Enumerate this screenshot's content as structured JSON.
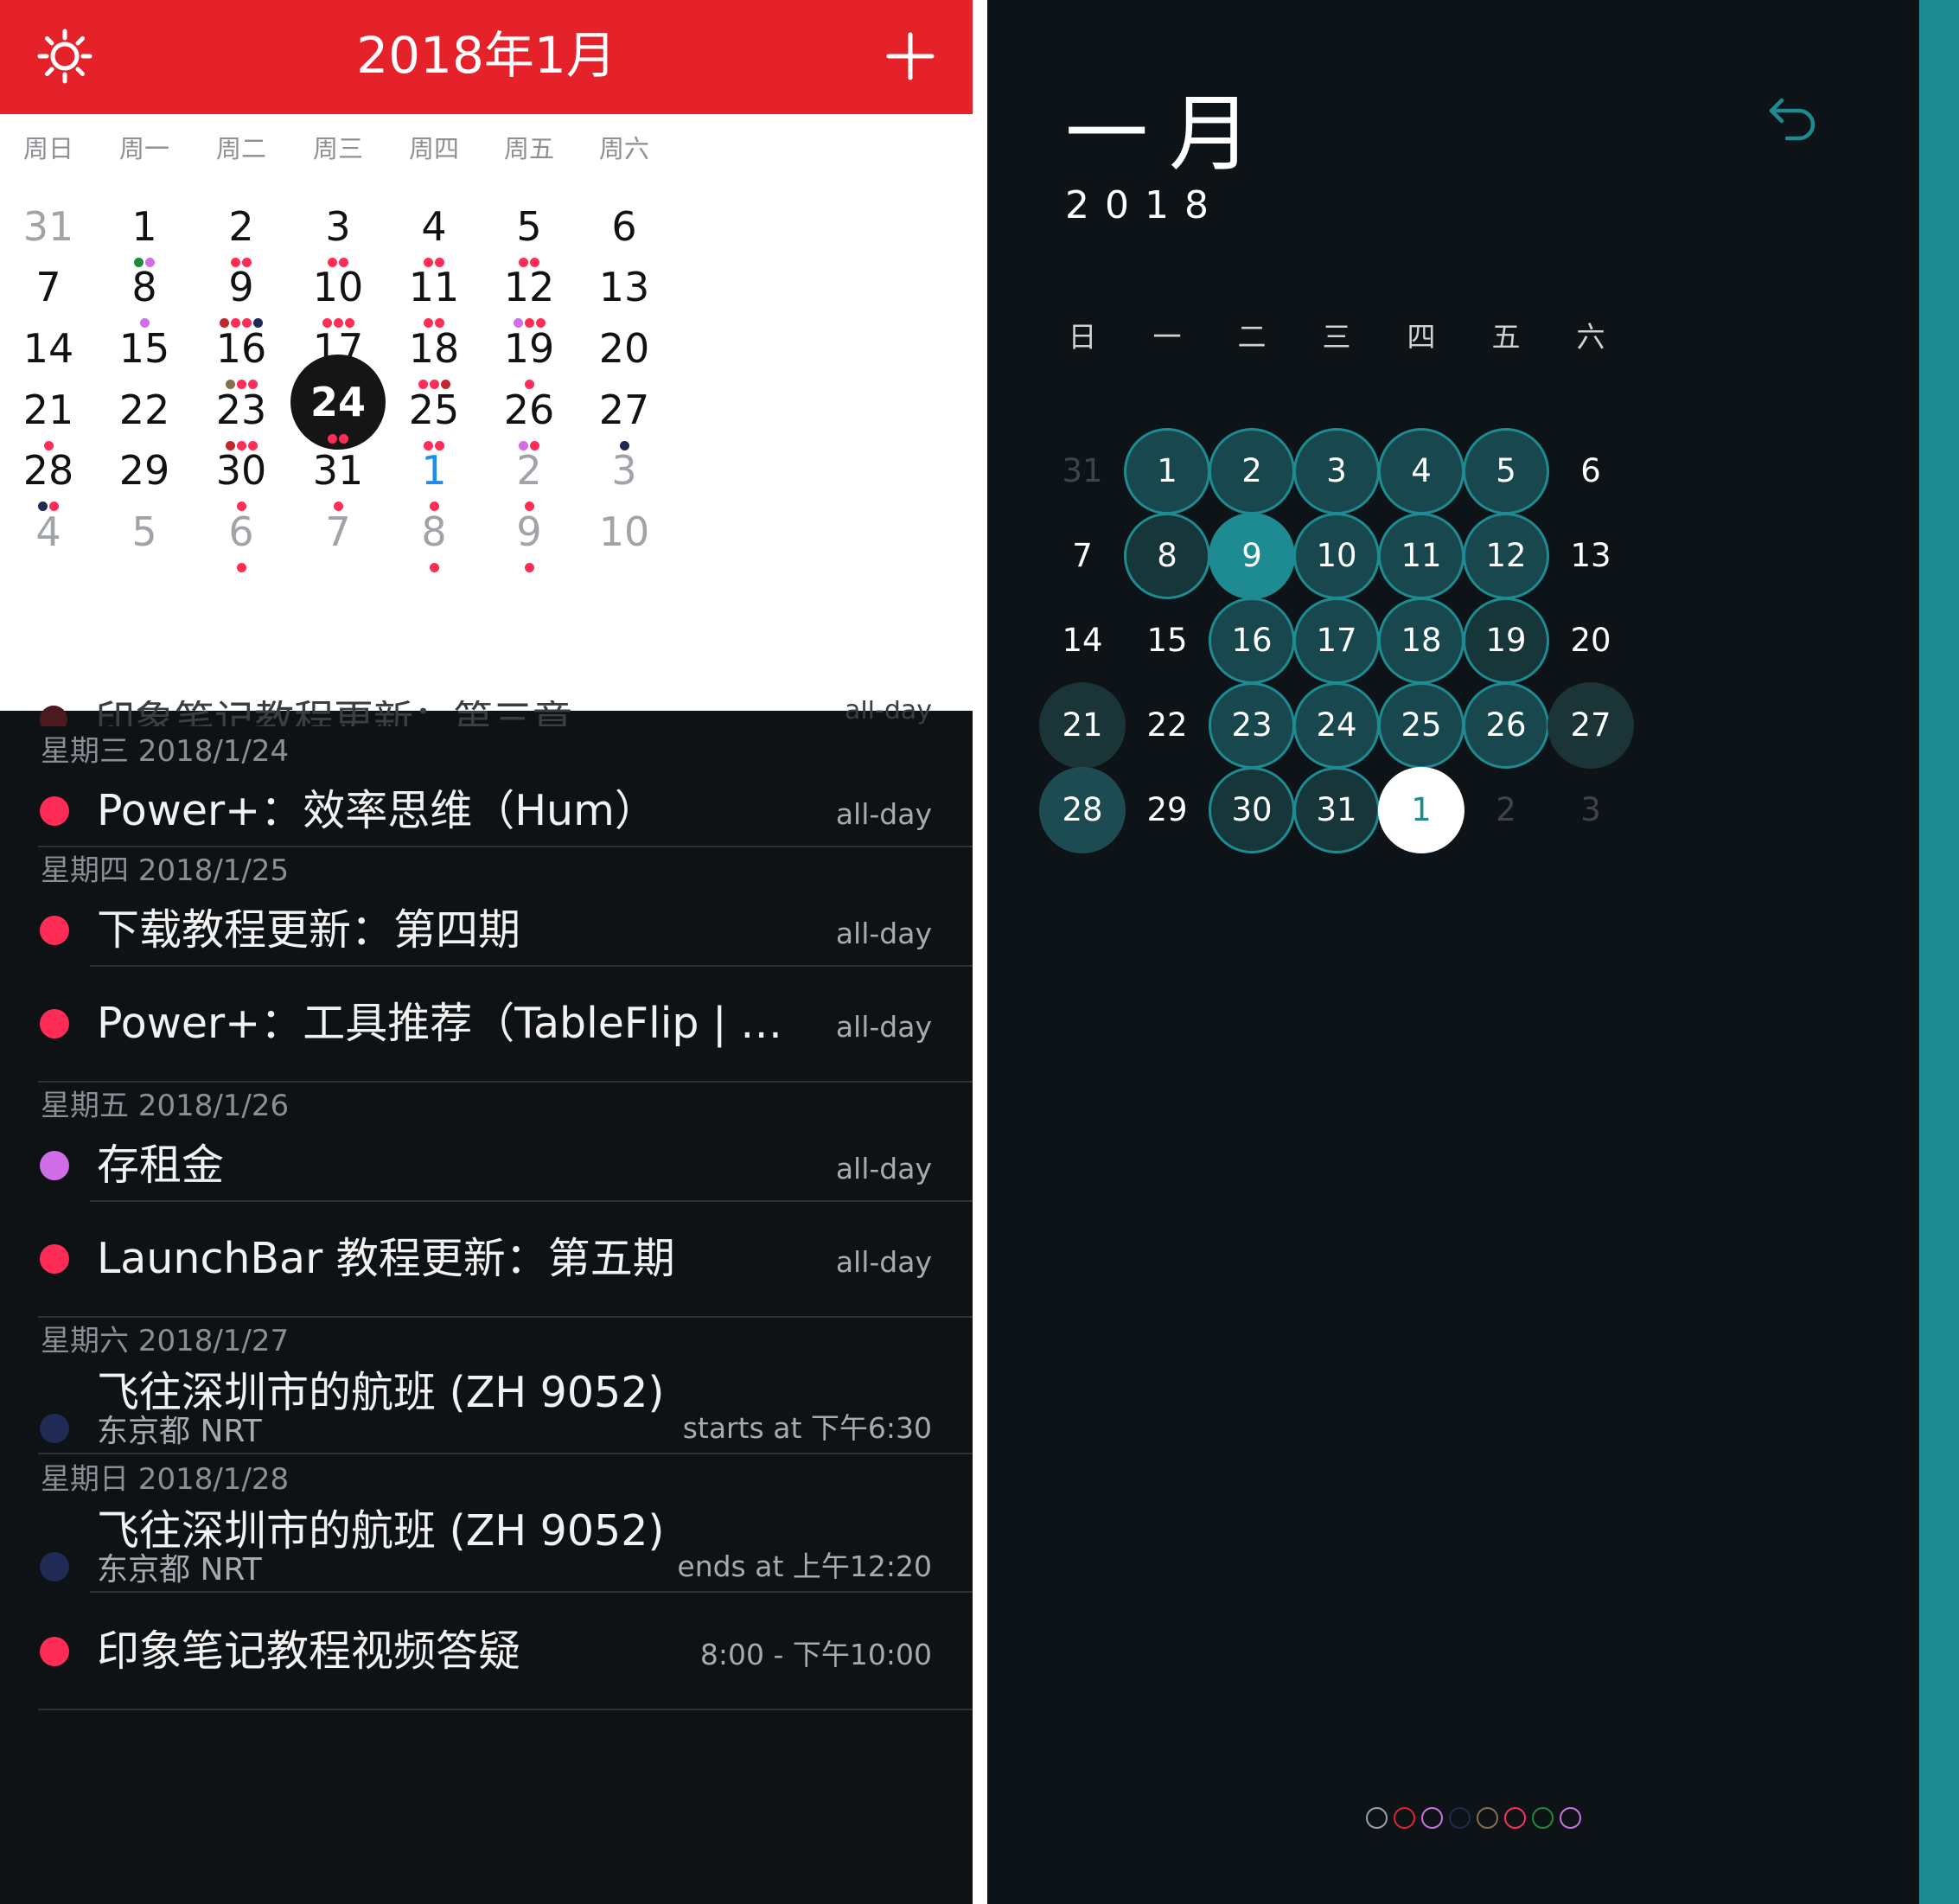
{
  "left": {
    "header": {
      "title": "2018年1月"
    },
    "weekdays": [
      "周日",
      "周一",
      "周二",
      "周三",
      "周四",
      "周五",
      "周六"
    ],
    "weeks": [
      [
        {
          "d": "31",
          "muted": true,
          "dots": []
        },
        {
          "d": "1",
          "dots": [
            "#1f8a3a",
            "#cf6ee8"
          ]
        },
        {
          "d": "2",
          "dots": [
            "#ff2d55",
            "#ff2d55"
          ]
        },
        {
          "d": "3",
          "dots": [
            "#ff2d55",
            "#ff2d55"
          ]
        },
        {
          "d": "4",
          "dots": [
            "#ff2d55",
            "#ff2d55"
          ]
        },
        {
          "d": "5",
          "dots": [
            "#ff2d55",
            "#ff2d55"
          ]
        },
        {
          "d": "6",
          "dots": []
        }
      ],
      [
        {
          "d": "7",
          "dots": []
        },
        {
          "d": "8",
          "dots": [
            "#cf6ee8"
          ]
        },
        {
          "d": "9",
          "dots": [
            "#c0282e",
            "#ff2d55",
            "#ff2d55",
            "#1f2a55"
          ]
        },
        {
          "d": "10",
          "dots": [
            "#ff2d55",
            "#ff2d55",
            "#ff2d55"
          ]
        },
        {
          "d": "11",
          "dots": [
            "#ff2d55",
            "#ff2d55"
          ]
        },
        {
          "d": "12",
          "dots": [
            "#cf6ee8",
            "#ff2d55",
            "#ff2d55"
          ]
        },
        {
          "d": "13",
          "dots": []
        }
      ],
      [
        {
          "d": "14",
          "dots": []
        },
        {
          "d": "15",
          "dots": []
        },
        {
          "d": "16",
          "dots": [
            "#8a6d4a",
            "#ff2d55",
            "#ff2d55"
          ]
        },
        {
          "d": "17",
          "dots": [
            "#ff2d55",
            "#ff2d55",
            "#ff2d55"
          ]
        },
        {
          "d": "18",
          "dots": [
            "#ff2d55",
            "#ff2d55",
            "#c0282e"
          ]
        },
        {
          "d": "19",
          "dots": [
            "#ff2d55"
          ]
        },
        {
          "d": "20",
          "dots": []
        }
      ],
      [
        {
          "d": "21",
          "dots": [
            "#ff2d55"
          ]
        },
        {
          "d": "22",
          "dots": []
        },
        {
          "d": "23",
          "dots": [
            "#c0282e",
            "#ff2d55",
            "#ff2d55"
          ]
        },
        {
          "d": "24",
          "today": true,
          "dots": [
            "#ff2d55",
            "#ff2d55"
          ]
        },
        {
          "d": "25",
          "dots": [
            "#ff2d55",
            "#ff2d55"
          ]
        },
        {
          "d": "26",
          "dots": [
            "#cf6ee8",
            "#ff2d55"
          ]
        },
        {
          "d": "27",
          "dots": [
            "#1f2a55"
          ]
        }
      ],
      [
        {
          "d": "28",
          "dots": [
            "#1f2a55",
            "#ff2d55"
          ]
        },
        {
          "d": "29",
          "dots": []
        },
        {
          "d": "30",
          "dots": [
            "#ff2d55"
          ]
        },
        {
          "d": "31",
          "dots": [
            "#ff2d55"
          ]
        },
        {
          "d": "1",
          "blue": true,
          "dots": [
            "#ff2d55"
          ]
        },
        {
          "d": "2",
          "muted": true,
          "dots": [
            "#ff2d55"
          ]
        },
        {
          "d": "3",
          "muted": true,
          "dots": []
        }
      ],
      [
        {
          "d": "4",
          "muted": true,
          "dots": []
        },
        {
          "d": "5",
          "muted": true,
          "dots": []
        },
        {
          "d": "6",
          "muted": true,
          "dots": [
            "#ff2d55"
          ]
        },
        {
          "d": "7",
          "muted": true,
          "dots": []
        },
        {
          "d": "8",
          "muted": true,
          "dots": [
            "#ff2d55"
          ]
        },
        {
          "d": "9",
          "muted": true,
          "dots": [
            "#ff2d55"
          ]
        },
        {
          "d": "10",
          "muted": true,
          "dots": []
        }
      ]
    ],
    "ghost_event": {
      "title": "印象笔记教程更新：第三章",
      "time": "all-day"
    },
    "agenda": [
      {
        "header": "星期三 2018/1/24",
        "events": [
          {
            "title": "Power+：效率思维（Hum）",
            "time": "all-day",
            "color": "#ff2d55"
          }
        ]
      },
      {
        "header": "星期四 2018/1/25",
        "events": [
          {
            "title": "下载教程更新：第四期",
            "time": "all-day",
            "color": "#ff2d55"
          },
          {
            "title": "Power+：工具推荐（TableFlip | 文…",
            "time": "all-day",
            "color": "#ff2d55"
          }
        ]
      },
      {
        "header": "星期五 2018/1/26",
        "events": [
          {
            "title": "存租金",
            "time": "all-day",
            "color": "#cf6ee8"
          },
          {
            "title": "LaunchBar 教程更新：第五期",
            "time": "all-day",
            "color": "#ff2d55"
          }
        ]
      },
      {
        "header": "星期六 2018/1/27",
        "events": [
          {
            "title": "飞往深圳市的航班 (ZH 9052)",
            "subtitle": "东京都 NRT",
            "time": "starts at 下午6:30",
            "color": "#1f2a55"
          }
        ]
      },
      {
        "header": "星期日 2018/1/28",
        "events": [
          {
            "title": "飞往深圳市的航班 (ZH 9052)",
            "subtitle": "东京都 NRT",
            "time": "ends at 上午12:20",
            "color": "#1f2a55"
          },
          {
            "title": "印象笔记教程视频答疑",
            "time": "8:00 - 下午10:00",
            "color": "#ff2d55"
          }
        ]
      }
    ]
  },
  "right": {
    "month": "一月",
    "year": "2018",
    "weekdays": [
      "日",
      "一",
      "二",
      "三",
      "四",
      "五",
      "六"
    ],
    "weeks": [
      [
        {
          "d": "31",
          "s": "muted"
        },
        {
          "d": "1",
          "s": "ring"
        },
        {
          "d": "2",
          "s": "ring"
        },
        {
          "d": "3",
          "s": "ring"
        },
        {
          "d": "4",
          "s": "ring"
        },
        {
          "d": "5",
          "s": "ring"
        },
        {
          "d": "6",
          "s": "plain"
        }
      ],
      [
        {
          "d": "7",
          "s": "plain"
        },
        {
          "d": "8",
          "s": "ringdark"
        },
        {
          "d": "9",
          "s": "bright"
        },
        {
          "d": "10",
          "s": "ring"
        },
        {
          "d": "11",
          "s": "ring"
        },
        {
          "d": "12",
          "s": "ring"
        },
        {
          "d": "13",
          "s": "plain"
        }
      ],
      [
        {
          "d": "14",
          "s": "plain"
        },
        {
          "d": "15",
          "s": "plain"
        },
        {
          "d": "16",
          "s": "ring"
        },
        {
          "d": "17",
          "s": "ring"
        },
        {
          "d": "18",
          "s": "ring"
        },
        {
          "d": "19",
          "s": "ringdark"
        },
        {
          "d": "20",
          "s": "plain"
        }
      ],
      [
        {
          "d": "21",
          "s": "dark"
        },
        {
          "d": "22",
          "s": "plain"
        },
        {
          "d": "23",
          "s": "ring"
        },
        {
          "d": "24",
          "s": "ring"
        },
        {
          "d": "25",
          "s": "ring"
        },
        {
          "d": "26",
          "s": "ring"
        },
        {
          "d": "27",
          "s": "dark"
        }
      ],
      [
        {
          "d": "28",
          "s": "mid"
        },
        {
          "d": "29",
          "s": "plain"
        },
        {
          "d": "30",
          "s": "ringdark"
        },
        {
          "d": "31",
          "s": "ringdark"
        },
        {
          "d": "1",
          "s": "white"
        },
        {
          "d": "2",
          "s": "muted"
        },
        {
          "d": "3",
          "s": "muted"
        }
      ]
    ],
    "calendar_colors": [
      "#9aa0a6",
      "#e52129",
      "#cf6ee8",
      "#1f2a55",
      "#8a6d4a",
      "#ff2d55",
      "#1f8a3a",
      "#cf6ee8"
    ]
  }
}
